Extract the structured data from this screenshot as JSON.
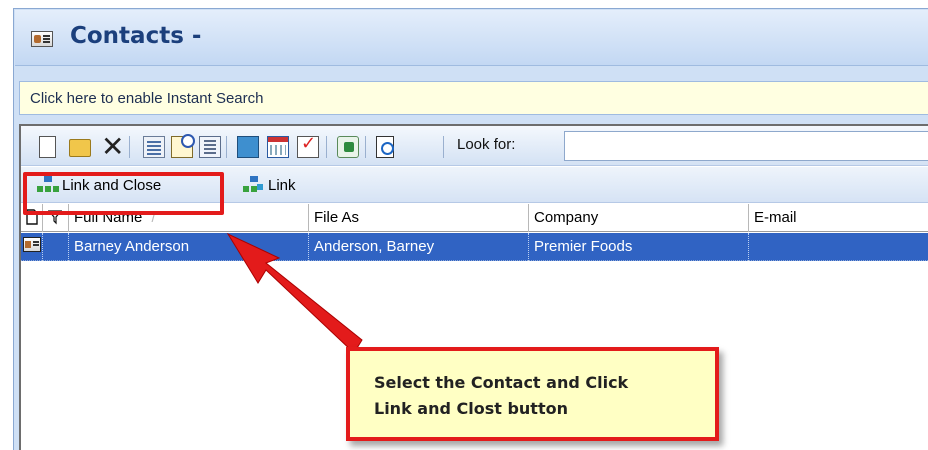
{
  "window": {
    "title": "Contacts -"
  },
  "instant_search": {
    "text": "Click here to enable Instant Search"
  },
  "toolbar": {
    "icons": [
      "new-icon",
      "open-icon",
      "delete-icon",
      "card-view-icon",
      "mail-merge-icon",
      "details-view-icon",
      "link-icon",
      "calendar-icon",
      "task-icon",
      "excel-icon",
      "find-icon"
    ],
    "look_for_label": "Look for:",
    "look_for_value": ""
  },
  "link_toolbar": {
    "link_and_close_label": "Link and Close",
    "link_label": "Link"
  },
  "grid": {
    "columns": {
      "full_name": "Full Name",
      "sort_indicator": "/",
      "file_as": "File As",
      "company": "Company",
      "email": "E-mail"
    },
    "rows": [
      {
        "full_name": "Barney Anderson",
        "file_as": "Anderson, Barney",
        "company": "Premier Foods",
        "email": ""
      }
    ]
  },
  "annotation": {
    "text": "Select the Contact and Click\nLink and Clost button",
    "color": "#e31b1b"
  },
  "colors": {
    "selection": "#3063c3",
    "title": "#1b3f7c",
    "header_bg": "#cfe0f5"
  }
}
